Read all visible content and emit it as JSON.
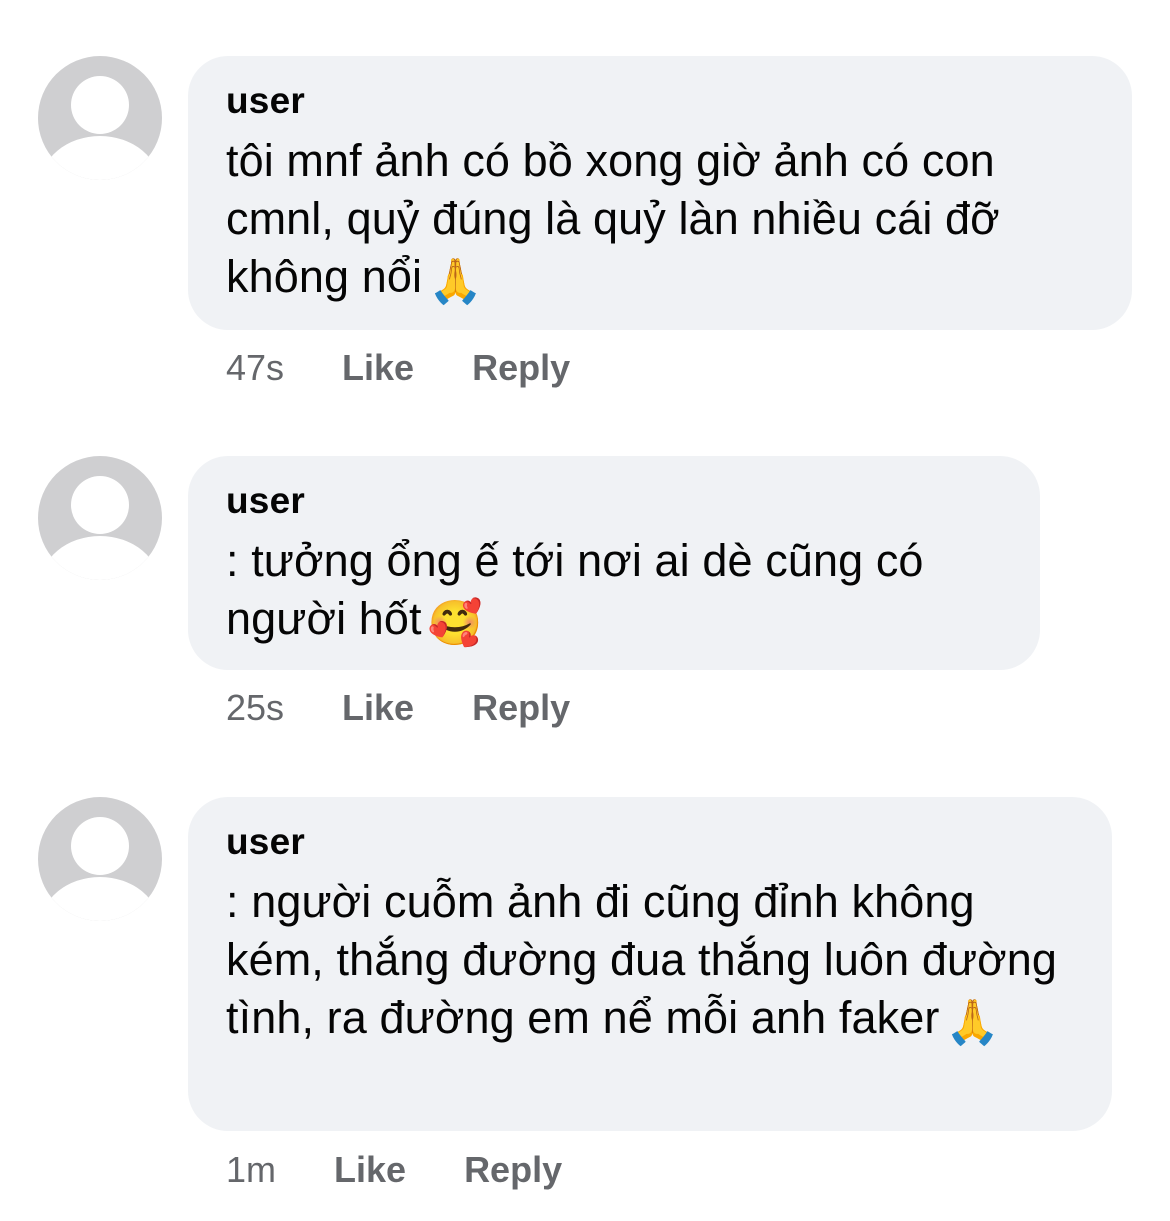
{
  "comments": [
    {
      "username": "user",
      "text": "tôi mnf ảnh có bồ xong giờ ảnh có con cmnl, quỷ đúng là quỷ làn nhiều cái đỡ không nổi",
      "emoji": "🙏",
      "emoji_name": "folded-hands-icon",
      "time": "47s",
      "like_label": "Like",
      "reply_label": "Reply"
    },
    {
      "username": "user",
      "text": ": tưởng ổng ế tới nơi ai dè cũng có người hốt",
      "emoji": "🥰",
      "emoji_name": "smiling-face-with-hearts-icon",
      "time": "25s",
      "like_label": "Like",
      "reply_label": "Reply"
    },
    {
      "username": "user",
      "text": ": người cuỗm ảnh đi cũng đỉnh không kém, thắng đường đua thắng luôn đường tình, ra đường em nể mỗi anh faker",
      "emoji": "🙏",
      "emoji_name": "folded-hands-icon",
      "time": "1m",
      "like_label": "Like",
      "reply_label": "Reply"
    }
  ],
  "colors": {
    "bubble_background": "#f0f2f5",
    "text": "#050505",
    "meta_text": "#65676b",
    "avatar_background": "#cfcfd1"
  }
}
